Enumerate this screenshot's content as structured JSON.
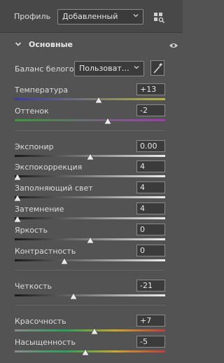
{
  "header": {
    "profile_label": "Профиль",
    "profile_value": "Добавленный",
    "grid_icon": "grid-search-icon"
  },
  "section": {
    "title": "Основные",
    "visibility_icon": "eye-icon"
  },
  "white_balance": {
    "label": "Баланс белого",
    "value": "Пользоват…",
    "picker_icon": "eyedropper-icon"
  },
  "sliders": [
    {
      "label": "Температура",
      "value": "+13",
      "position": 0.56,
      "track": [
        "#3a3aa8",
        "#b8b840"
      ]
    },
    {
      "label": "Оттенок",
      "value": "-2",
      "position": 0.62,
      "track": [
        "#3a9a3a",
        "#a03ab0"
      ]
    },
    {
      "label": "Экспонир",
      "value": "0.00",
      "position": 0.5,
      "track": [
        "#1a1a1a",
        "#ececec"
      ]
    },
    {
      "label": "Экспокоррекция",
      "value": "4",
      "position": 0.02,
      "track": [
        "#1a1a1a",
        "#ececec"
      ]
    },
    {
      "label": "Заполняющий свет",
      "value": "4",
      "position": 0.02,
      "track": [
        "#1a1a1a",
        "#ececec"
      ]
    },
    {
      "label": "Затемнение",
      "value": "4",
      "position": 0.02,
      "track": [
        "#1a1a1a",
        "#ececec"
      ]
    },
    {
      "label": "Яркость",
      "value": "0",
      "position": 0.5,
      "track": [
        "#1a1a1a",
        "#ececec"
      ]
    },
    {
      "label": "Контрастность",
      "value": "0",
      "position": 0.33,
      "track": [
        "#1a1a1a",
        "#ececec"
      ]
    },
    {
      "label": "Четкость",
      "value": "-21",
      "position": 0.39,
      "track": [
        "#1a1a1a",
        "#ececec"
      ]
    },
    {
      "label": "Красочность",
      "value": "+7",
      "position": 0.53,
      "track": [
        "#8a8a8a",
        "#2aa05a",
        "#c8a830",
        "#c83a3a"
      ]
    },
    {
      "label": "Насыщенность",
      "value": "-5",
      "position": 0.47,
      "track": [
        "#8a8a8a",
        "#2aa05a",
        "#c8a830",
        "#c83a3a"
      ]
    }
  ]
}
